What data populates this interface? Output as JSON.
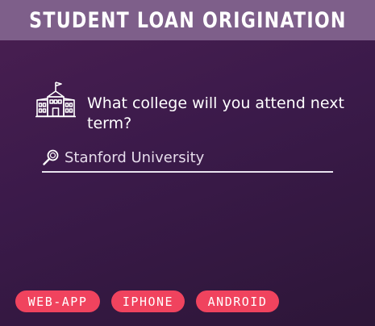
{
  "header": {
    "title": "STUDENT LOAN ORIGINATION"
  },
  "question": {
    "text": "What college will you attend next term?",
    "icon": "college-building-icon"
  },
  "search": {
    "value": "Stanford University",
    "icon": "search-icon"
  },
  "platforms": {
    "items": [
      {
        "label": "WEB-APP"
      },
      {
        "label": "IPHONE"
      },
      {
        "label": "ANDROID"
      }
    ]
  },
  "colors": {
    "background_top": "#4a1f52",
    "background_bottom": "#2d1638",
    "header_bg": "#7e5f8a",
    "pill_bg": "#f0435e",
    "text": "#ffffff"
  }
}
